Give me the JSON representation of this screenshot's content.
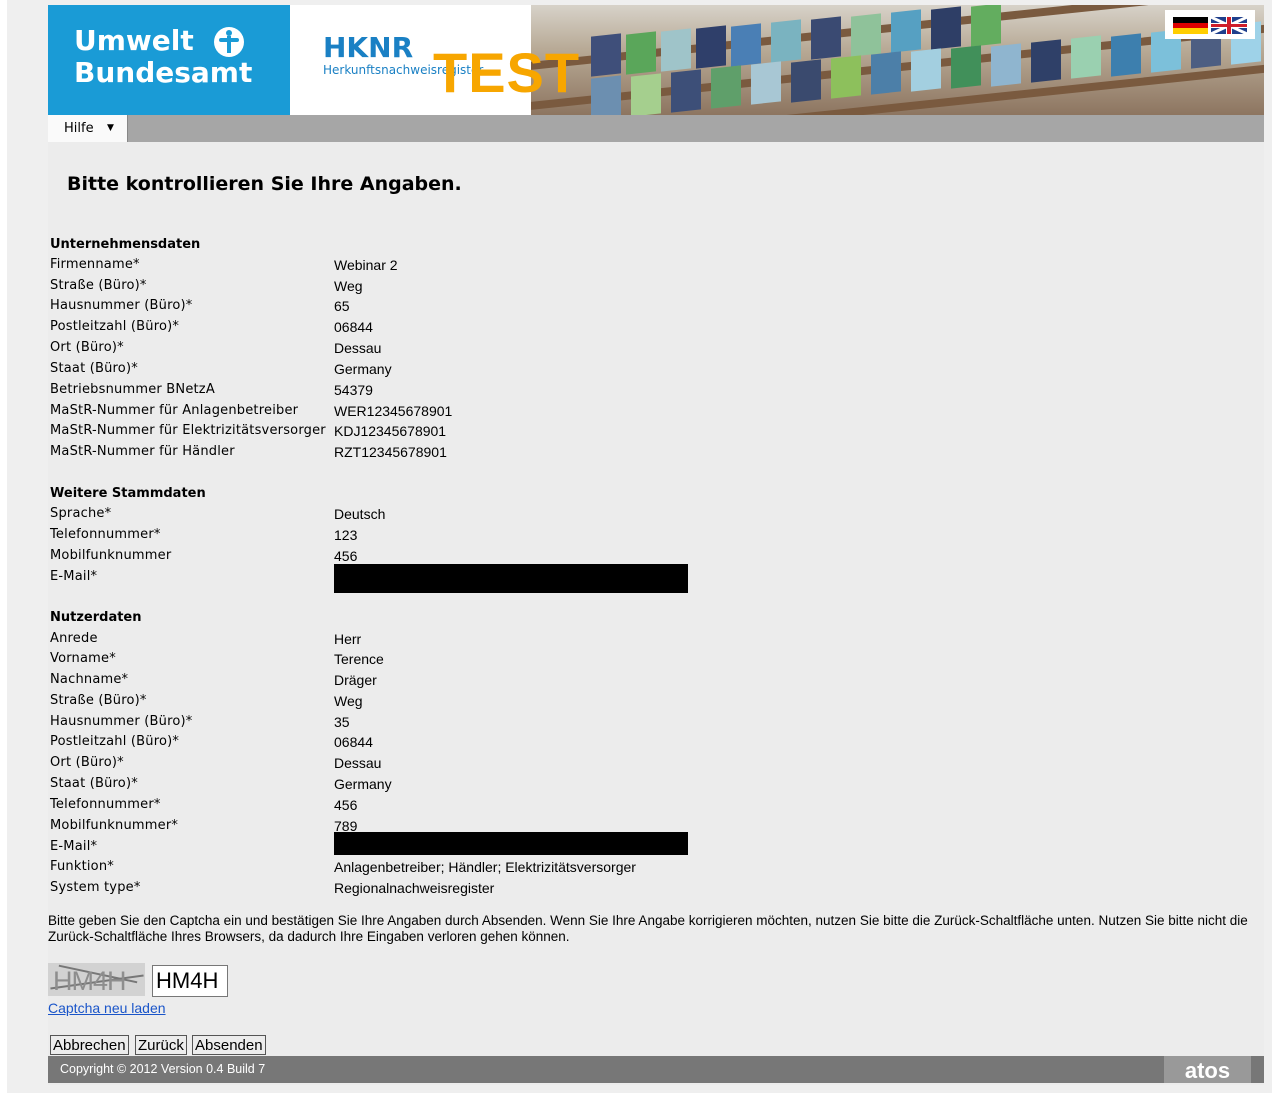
{
  "header": {
    "logo_line1": "Umwelt",
    "logo_line2": "Bundesamt",
    "app_title": "HKNR",
    "app_subtitle": "Herkunftsnachweisregister",
    "test_label": "TEST",
    "icons": [
      "uba-logo-icon",
      "flag-de-icon",
      "flag-uk-icon"
    ],
    "colors": {
      "brand_blue": "#1a9bd6",
      "test_orange": "#f7a600",
      "menu_gray": "#a6a6a6"
    }
  },
  "menu": {
    "hilfe_label": "Hilfe",
    "caret": "▼"
  },
  "page_title": "Bitte kontrollieren Sie Ihre Angaben.",
  "sections": {
    "company": {
      "title": "Unternehmensdaten",
      "rows": [
        {
          "label": "Firmenname*",
          "value": "Webinar 2"
        },
        {
          "label": "Straße (Büro)*",
          "value": "Weg"
        },
        {
          "label": "Hausnummer (Büro)*",
          "value": "65"
        },
        {
          "label": "Postleitzahl (Büro)*",
          "value": "06844"
        },
        {
          "label": "Ort (Büro)*",
          "value": "Dessau"
        },
        {
          "label": "Staat (Büro)*",
          "value": "Germany"
        },
        {
          "label": "Betriebsnummer BNetzA",
          "value": "54379"
        },
        {
          "label": "MaStR-Nummer für Anlagenbetreiber",
          "value": "WER12345678901"
        },
        {
          "label": "MaStR-Nummer für Elektrizitätsversorger",
          "value": "KDJ12345678901"
        },
        {
          "label": "MaStR-Nummer für Händler",
          "value": "RZT12345678901"
        }
      ]
    },
    "master": {
      "title": "Weitere Stammdaten",
      "rows": [
        {
          "label": "Sprache*",
          "value": "Deutsch"
        },
        {
          "label": "Telefonnummer*",
          "value": "123"
        },
        {
          "label": "Mobilfunknummer",
          "value": "456"
        },
        {
          "label": "E-Mail*",
          "value": ""
        }
      ]
    },
    "user": {
      "title": "Nutzerdaten",
      "rows": [
        {
          "label": "Anrede",
          "value": "Herr"
        },
        {
          "label": "Vorname*",
          "value": "Terence"
        },
        {
          "label": "Nachname*",
          "value": "Dräger"
        },
        {
          "label": "Straße (Büro)*",
          "value": "Weg"
        },
        {
          "label": "Hausnummer (Büro)*",
          "value": "35"
        },
        {
          "label": "Postleitzahl (Büro)*",
          "value": "06844"
        },
        {
          "label": "Ort (Büro)*",
          "value": "Dessau"
        },
        {
          "label": "Staat (Büro)*",
          "value": "Germany"
        },
        {
          "label": "Telefonnummer*",
          "value": "456"
        },
        {
          "label": "Mobilfunknummer*",
          "value": "789"
        },
        {
          "label": "E-Mail*",
          "value": ""
        },
        {
          "label": "Funktion*",
          "value": "Anlagenbetreiber; Händler; Elektrizitätsversorger"
        },
        {
          "label": "System type*",
          "value": "Regionalnachweisregister"
        }
      ]
    }
  },
  "notice": "Bitte geben Sie den Captcha ein und bestätigen Sie Ihre Angaben durch Absenden. Wenn Sie Ihre Angabe korrigieren möchten, nutzen Sie bitte die Zurück-Schaltfläche unten. Nutzen Sie bitte nicht die Zurück-Schaltfläche Ihres Browsers, da dadurch Ihre Eingaben verloren gehen können.",
  "captcha": {
    "image_text": "HM4H",
    "input_value": "HM4H",
    "reload_link": "Captcha neu laden"
  },
  "buttons": {
    "cancel": "Abbrechen",
    "back": "Zurück",
    "submit": "Absenden"
  },
  "footer": {
    "copyright": "Copyright © 2012   Version 0.4 Build 7",
    "vendor": "atos"
  }
}
